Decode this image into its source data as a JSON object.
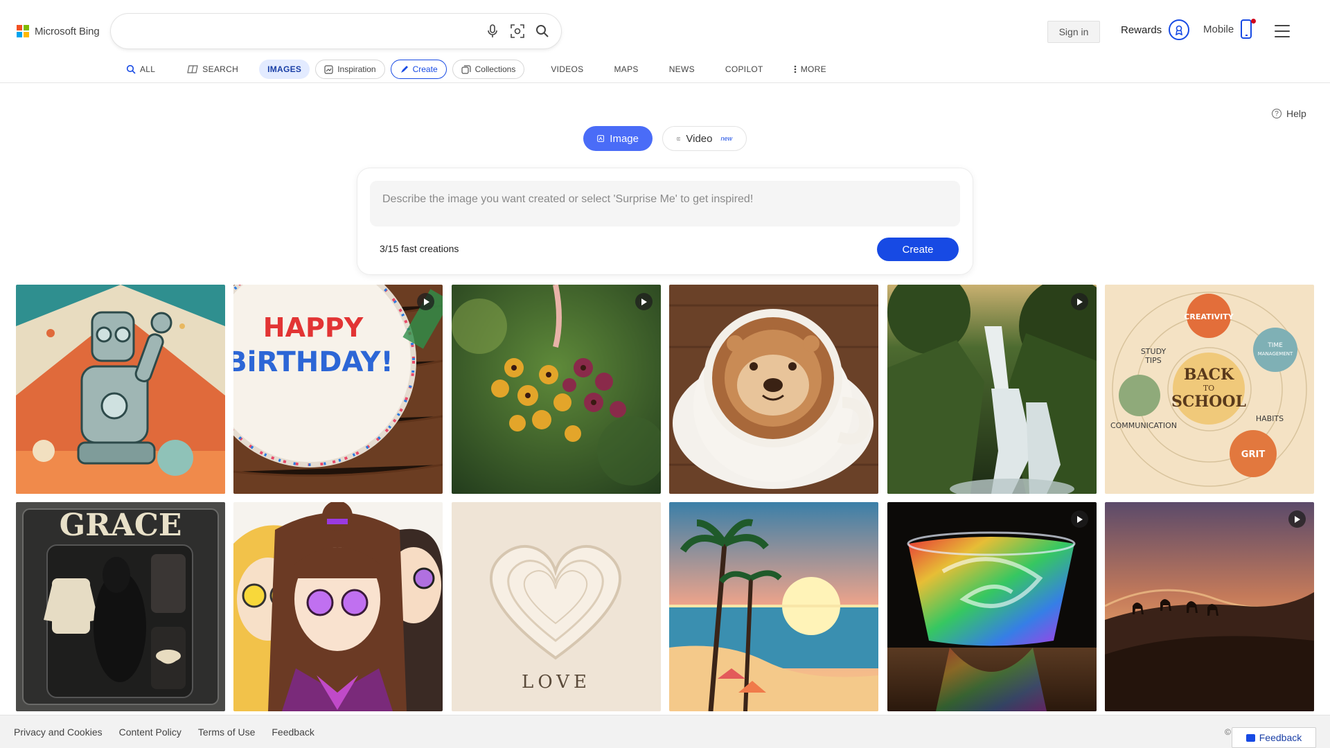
{
  "brand": {
    "name": "Microsoft Bing"
  },
  "search": {
    "value": "",
    "placeholder": ""
  },
  "header": {
    "signin_label": "Sign in",
    "rewards_label": "Rewards",
    "mobile_label": "Mobile"
  },
  "nav": {
    "items": [
      {
        "label": "ALL",
        "icon": "search-icon"
      },
      {
        "label": "SEARCH",
        "icon": "copilot-icon"
      },
      {
        "label": "IMAGES",
        "active": true
      },
      {
        "label": "Inspiration",
        "icon": "inspiration-icon"
      },
      {
        "label": "Create",
        "icon": "create-icon"
      },
      {
        "label": "Collections",
        "icon": "collections-icon"
      },
      {
        "label": "VIDEOS"
      },
      {
        "label": "MAPS"
      },
      {
        "label": "NEWS"
      },
      {
        "label": "COPILOT"
      },
      {
        "label": "MORE",
        "icon": "kebab-icon"
      }
    ]
  },
  "help_label": "Help",
  "modes": {
    "image_label": "Image",
    "video_label": "Video",
    "video_badge": "new"
  },
  "creator": {
    "prompt_value": "",
    "prompt_placeholder": "Describe the image you want created or select 'Surprise Me' to get inspired!",
    "fast_creations": "3/15 fast creations",
    "create_label": "Create"
  },
  "gallery": {
    "tiles": [
      {
        "subject": "retro robot waving poster",
        "video": false
      },
      {
        "subject": "birthday cake",
        "video": true,
        "text_lines": [
          "HAPPY",
          "BiRTHDAY!"
        ]
      },
      {
        "subject": "hanging flower cluster",
        "video": true
      },
      {
        "subject": "otter latte art",
        "video": false
      },
      {
        "subject": "forest waterfall",
        "video": true
      },
      {
        "subject": "back to school mind map",
        "video": false,
        "text_lines": [
          "CREATIVITY",
          "STUDY",
          "TIPS",
          "TIME",
          "MANAGEMENT",
          "BACK",
          "TO",
          "SCHOOL",
          "COMMUNICATION",
          "HABITS",
          "GRIT"
        ]
      },
      {
        "subject": "dog action figure box",
        "video": false,
        "text_lines": [
          "GRACE"
        ]
      },
      {
        "subject": "anime characters trio",
        "video": false
      },
      {
        "subject": "paper heart",
        "video": false,
        "text_lines": [
          "LOVE"
        ]
      },
      {
        "subject": "pixel art beach sunset",
        "video": false
      },
      {
        "subject": "rainbow swirl glass",
        "video": true
      },
      {
        "subject": "desert camel caravan",
        "video": true
      }
    ]
  },
  "footer": {
    "links": [
      "Privacy and Cookies",
      "Content Policy",
      "Terms of Use",
      "Feedback"
    ],
    "copyright_mark": "©",
    "feedback_button": "Feedback"
  },
  "colors": {
    "accent": "#174ae4",
    "image_mode": "#4a6cf7",
    "active_tab_bg": "#e3ebff"
  }
}
